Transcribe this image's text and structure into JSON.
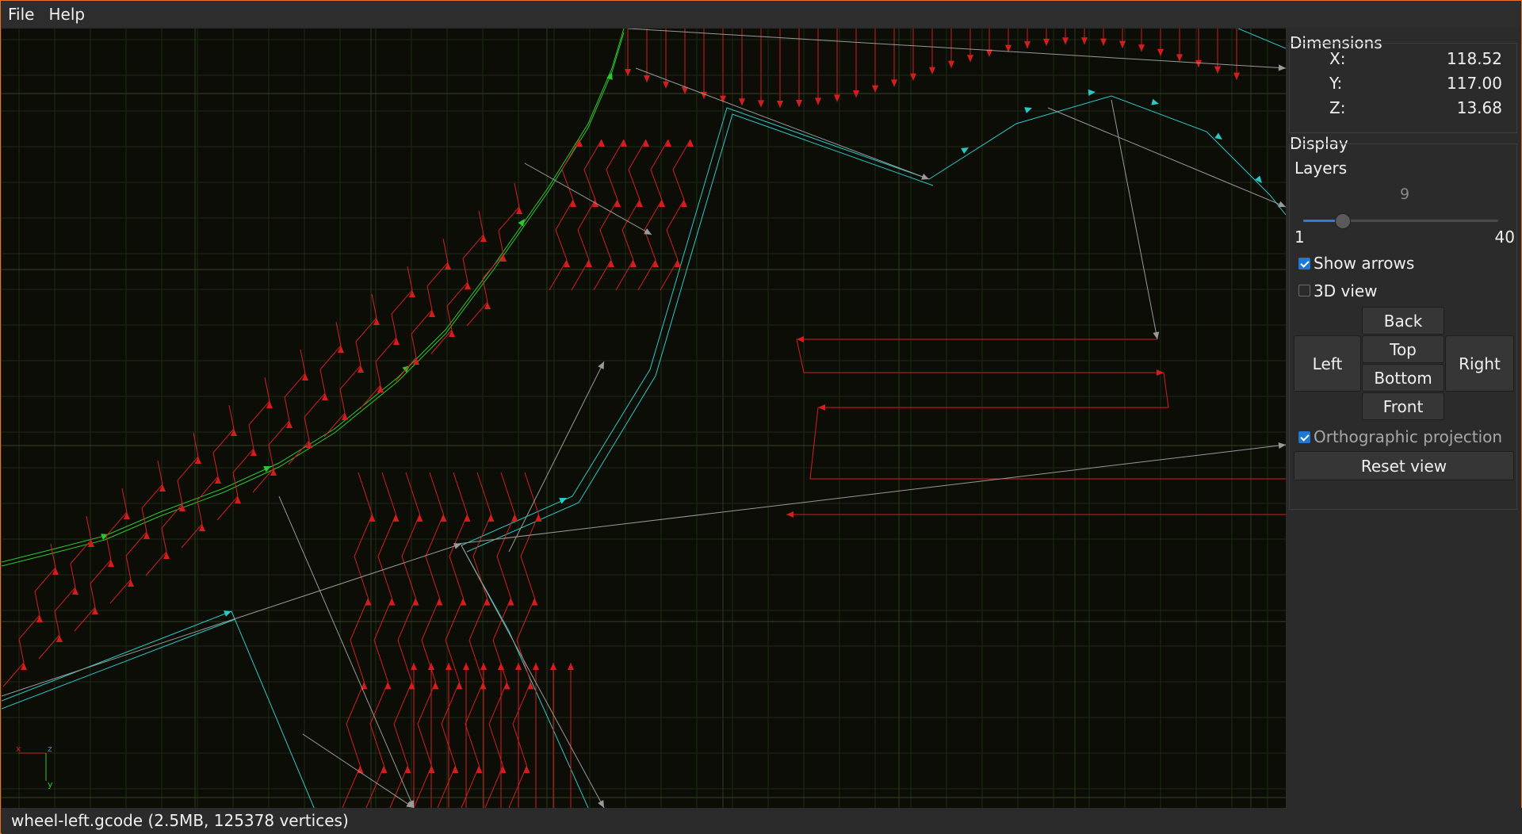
{
  "menubar": {
    "items": [
      "File",
      "Help"
    ]
  },
  "dimensions": {
    "title": "Dimensions",
    "x_label": "X:",
    "x_value": "118.52",
    "y_label": "Y:",
    "y_value": "117.00",
    "z_label": "Z:",
    "z_value": "13.68"
  },
  "display": {
    "title": "Display",
    "layers_label": "Layers",
    "layer_current": "9",
    "layer_min": "1",
    "layer_max": "40",
    "layer_fraction": 0.205,
    "show_arrows_label": "Show arrows",
    "show_arrows_checked": true,
    "view3d_label": "3D view",
    "view3d_checked": false,
    "ortho_label": "Orthographic projection",
    "ortho_checked": true,
    "buttons": {
      "back": "Back",
      "top": "Top",
      "bottom": "Bottom",
      "front": "Front",
      "left": "Left",
      "right": "Right",
      "reset": "Reset view"
    }
  },
  "axes": {
    "x": "x",
    "z": "z",
    "y": "y"
  },
  "status": {
    "text": "wheel-left.gcode (2.5MB, 125378 vertices)"
  },
  "colors": {
    "extrude": "#d41e1e",
    "travel": "#9a9a9a",
    "outer_wall": "#2bc8c8",
    "green_path": "#2ec82e",
    "accent": "#e8742a"
  }
}
